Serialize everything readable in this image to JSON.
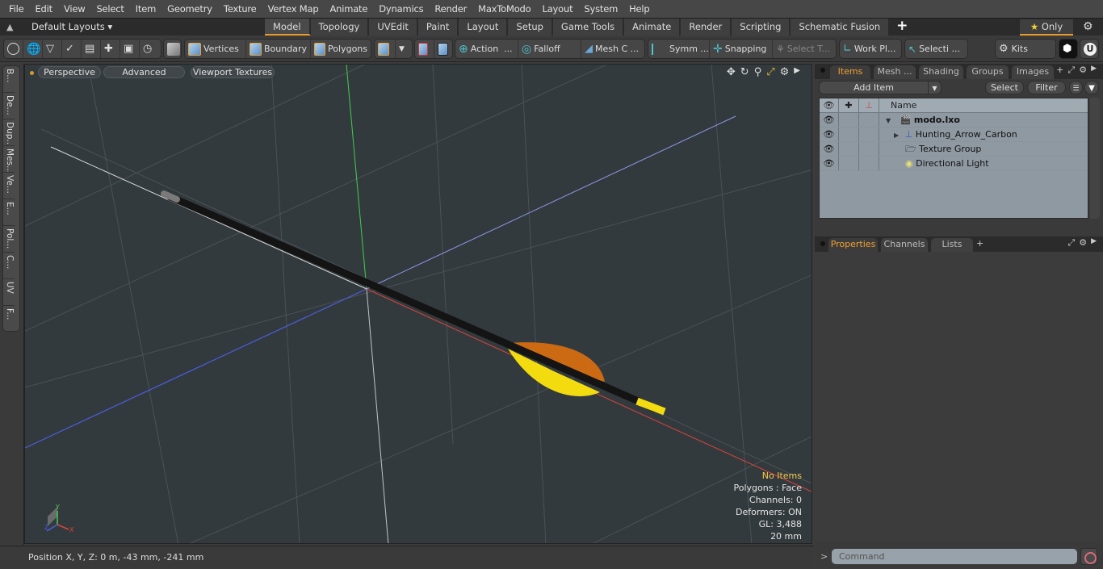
{
  "menu": [
    "File",
    "Edit",
    "View",
    "Select",
    "Item",
    "Geometry",
    "Texture",
    "Vertex Map",
    "Animate",
    "Dynamics",
    "Render",
    "MaxToModo",
    "Layout",
    "System",
    "Help"
  ],
  "layout_selector": "Default Layouts ▾",
  "tabs": [
    "Model",
    "Topology",
    "UVEdit",
    "Paint",
    "Layout",
    "Setup",
    "Game Tools",
    "Animate",
    "Render",
    "Scripting",
    "Schematic Fusion"
  ],
  "active_tab": "Model",
  "only_label": "Only",
  "toolbar": {
    "vertices": "Vertices",
    "boundary": "Boundary",
    "polygons": "Polygons",
    "action": "Action",
    "action_more": "...",
    "falloff": "Falloff",
    "mesh_c": "Mesh C ...",
    "symm": "Symm ...",
    "snapping": "Snapping",
    "select_t": "Select T...",
    "work_pl": "Work Pl...",
    "selecti": "Selecti ...",
    "kits": "Kits"
  },
  "left_toolbar": [
    "B...",
    "De...",
    "Dup...",
    "Mes...",
    "Ve...",
    "E...",
    "Pol...",
    "C...",
    "UV",
    "F..."
  ],
  "viewport": {
    "view_mode": "Perspective",
    "advanced": "Advanced",
    "textures": "Viewport Textures",
    "info": {
      "selection": "No Items",
      "polygons": "Polygons : Face",
      "channels": "Channels: 0",
      "deformers": "Deformers: ON",
      "gl": "GL: 3,488",
      "scale": "20 mm"
    },
    "axes": {
      "x": "X",
      "y": "Y",
      "z": "Z"
    }
  },
  "status": {
    "position": "Position X, Y, Z:   0 m, -43 mm, -241 mm"
  },
  "items_panel": {
    "tabs": [
      "Items",
      "Mesh ...",
      "Shading",
      "Groups",
      "Images"
    ],
    "active": "Items",
    "add_item": "Add Item",
    "select": "Select",
    "filter": "Filter",
    "name_header": "Name",
    "rows": [
      {
        "name": "modo.lxo",
        "icon": "scene-icon",
        "bold": true
      },
      {
        "name": "Hunting_Arrow_Carbon",
        "icon": "mesh-locator-icon"
      },
      {
        "name": "Texture Group",
        "icon": "folder-icon"
      },
      {
        "name": "Directional Light",
        "icon": "light-icon"
      }
    ]
  },
  "properties_panel": {
    "tabs": [
      "Properties",
      "Channels",
      "Lists"
    ],
    "active": "Properties"
  },
  "command": {
    "placeholder": "Command",
    "prompt": ">"
  },
  "colors": {
    "accent": "#e89b2a",
    "x_axis": "#d9443a",
    "y_axis": "#3fcf4a",
    "z_axis": "#4a5ee0",
    "arrow_shaft": "#141414",
    "fletch_orange": "#cc6a14",
    "fletch_yellow": "#f2dc10"
  }
}
